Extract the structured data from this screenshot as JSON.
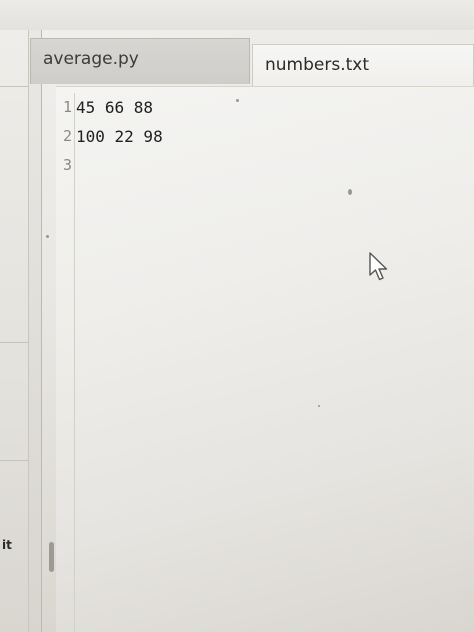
{
  "tabs": [
    {
      "label": "average.py",
      "active": false
    },
    {
      "label": "numbers.txt",
      "active": true
    }
  ],
  "editor": {
    "line_numbers": [
      "1",
      "2",
      "3"
    ],
    "lines": [
      "45 66 88",
      "100 22 98",
      ""
    ]
  },
  "sidebar": {
    "partial_text": "it"
  },
  "icons": {
    "pointer": "mouse-pointer-icon"
  },
  "colors": {
    "editor_background": "#f1f0ee",
    "active_tab": "#f6f6f4",
    "inactive_tab": "#d3d2cf"
  }
}
